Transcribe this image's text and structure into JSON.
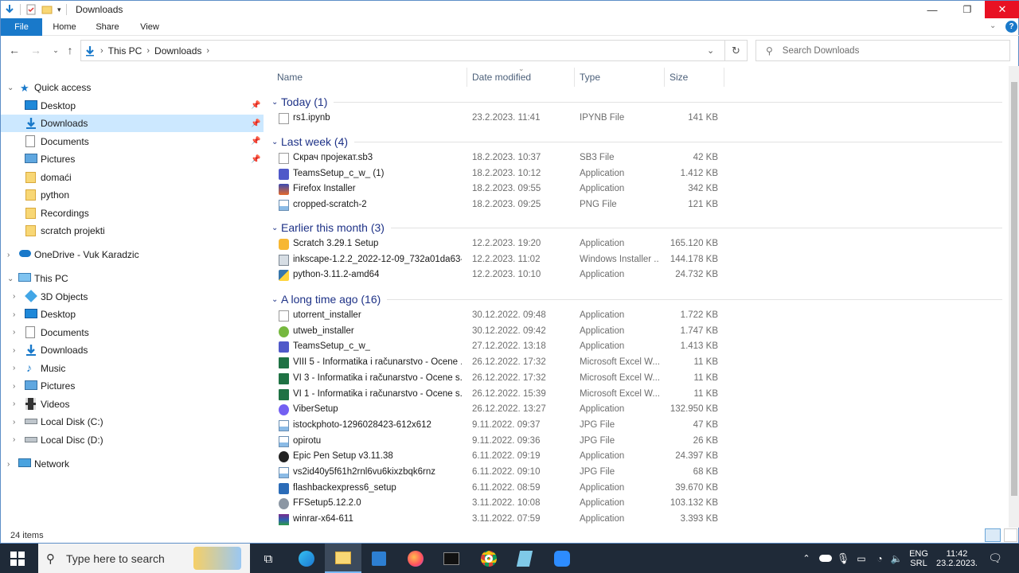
{
  "window": {
    "title": "Downloads",
    "accent": "#1979ca",
    "close_color": "#e81123"
  },
  "ribbon": {
    "tabs": [
      "File",
      "Home",
      "Share",
      "View"
    ]
  },
  "address": {
    "crumbs": [
      "This PC",
      "Downloads"
    ],
    "search_placeholder": "Search Downloads"
  },
  "nav": {
    "quick_access": "Quick access",
    "quick_items": [
      "Desktop",
      "Downloads",
      "Documents",
      "Pictures",
      "domaći",
      "python",
      "Recordings",
      "scratch projekti"
    ],
    "onedrive": "OneDrive - Vuk Karadzic",
    "this_pc": "This PC",
    "pc_items": [
      "3D Objects",
      "Desktop",
      "Documents",
      "Downloads",
      "Music",
      "Pictures",
      "Videos",
      "Local Disk (C:)",
      "Local Disc (D:)"
    ],
    "network": "Network"
  },
  "columns": {
    "name": "Name",
    "date": "Date modified",
    "type": "Type",
    "size": "Size"
  },
  "groups": [
    {
      "title": "Today (1)",
      "files": [
        {
          "name": "rs1.ipynb",
          "date": "23.2.2023. 11:41",
          "type": "IPYNB File",
          "size": "141 KB",
          "icon": "blank-file-icon"
        }
      ]
    },
    {
      "title": "Last week (4)",
      "files": [
        {
          "name": "Скрач пројекат.sb3",
          "date": "18.2.2023. 10:37",
          "type": "SB3 File",
          "size": "42 KB",
          "icon": "blank-file-icon"
        },
        {
          "name": "TeamsSetup_c_w_ (1)",
          "date": "18.2.2023. 10:12",
          "type": "Application",
          "size": "1.412 KB",
          "icon": "teams-icon"
        },
        {
          "name": "Firefox Installer",
          "date": "18.2.2023. 09:55",
          "type": "Application",
          "size": "342 KB",
          "icon": "firefox-installer-icon"
        },
        {
          "name": "cropped-scratch-2",
          "date": "18.2.2023. 09:25",
          "type": "PNG File",
          "size": "121 KB",
          "icon": "image-file-icon"
        }
      ]
    },
    {
      "title": "Earlier this month (3)",
      "files": [
        {
          "name": "Scratch 3.29.1 Setup",
          "date": "12.2.2023. 19:20",
          "type": "Application",
          "size": "165.120 KB",
          "icon": "scratch-icon"
        },
        {
          "name": "inkscape-1.2.2_2022-12-09_732a01da63-x...",
          "date": "12.2.2023. 11:02",
          "type": "Windows Installer ...",
          "size": "144.178 KB",
          "icon": "installer-icon"
        },
        {
          "name": "python-3.11.2-amd64",
          "date": "12.2.2023. 10:10",
          "type": "Application",
          "size": "24.732 KB",
          "icon": "python-icon"
        }
      ]
    },
    {
      "title": "A long time ago (16)",
      "files": [
        {
          "name": "utorrent_installer",
          "date": "30.12.2022. 09:48",
          "type": "Application",
          "size": "1.722 KB",
          "icon": "blank-file-icon"
        },
        {
          "name": "utweb_installer",
          "date": "30.12.2022. 09:42",
          "type": "Application",
          "size": "1.747 KB",
          "icon": "utorrent-icon"
        },
        {
          "name": "TeamsSetup_c_w_",
          "date": "27.12.2022. 13:18",
          "type": "Application",
          "size": "1.413 KB",
          "icon": "teams-icon"
        },
        {
          "name": "VIII 5 - Informatika i računarstvo - Ocene ...",
          "date": "26.12.2022. 17:32",
          "type": "Microsoft Excel W...",
          "size": "11 KB",
          "icon": "excel-icon"
        },
        {
          "name": "VI 3 - Informatika i računarstvo - Ocene s...",
          "date": "26.12.2022. 17:32",
          "type": "Microsoft Excel W...",
          "size": "11 KB",
          "icon": "excel-icon"
        },
        {
          "name": "VI 1 - Informatika i računarstvo - Ocene s...",
          "date": "26.12.2022. 15:39",
          "type": "Microsoft Excel W...",
          "size": "11 KB",
          "icon": "excel-icon"
        },
        {
          "name": "ViberSetup",
          "date": "26.12.2022. 13:27",
          "type": "Application",
          "size": "132.950 KB",
          "icon": "viber-icon"
        },
        {
          "name": "istockphoto-1296028423-612x612",
          "date": "9.11.2022. 09:37",
          "type": "JPG File",
          "size": "47 KB",
          "icon": "image-file-icon"
        },
        {
          "name": "opirotu",
          "date": "9.11.2022. 09:36",
          "type": "JPG File",
          "size": "26 KB",
          "icon": "image-file-icon"
        },
        {
          "name": "Epic Pen Setup v3.11.38",
          "date": "6.11.2022. 09:19",
          "type": "Application",
          "size": "24.397 KB",
          "icon": "epic-pen-icon"
        },
        {
          "name": "vs2id40y5f61h2rnl6vu6kixzbqk6rnz",
          "date": "6.11.2022. 09:10",
          "type": "JPG File",
          "size": "68 KB",
          "icon": "image-file-icon"
        },
        {
          "name": "flashbackexpress6_setup",
          "date": "6.11.2022. 08:59",
          "type": "Application",
          "size": "39.670 KB",
          "icon": "flashback-icon"
        },
        {
          "name": "FFSetup5.12.2.0",
          "date": "3.11.2022. 10:08",
          "type": "Application",
          "size": "103.132 KB",
          "icon": "setup-icon"
        },
        {
          "name": "winrar-x64-611",
          "date": "3.11.2022. 07:59",
          "type": "Application",
          "size": "3.393 KB",
          "icon": "winrar-icon"
        }
      ]
    }
  ],
  "status": {
    "items": "24 items"
  },
  "taskbar": {
    "search_placeholder": "Type here to search",
    "lang1": "ENG",
    "lang2": "SRL",
    "time": "11:42",
    "date": "23.2.2023."
  }
}
